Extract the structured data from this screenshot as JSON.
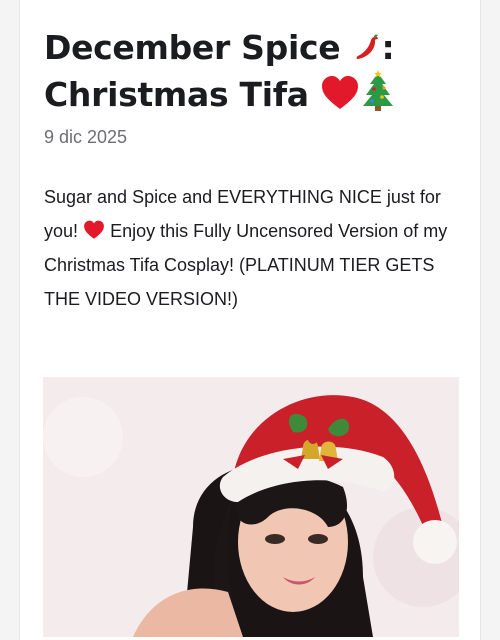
{
  "post": {
    "title": "December Spice 🌶️: Christmas Tifa ❤️🎄",
    "title_line1": "December Spice",
    "title_line1_suffix": ":",
    "title_line2": "Christmas Tifa",
    "date": "9 dic 2025",
    "body_part1": "Sugar and Spice and EVERYTHING NICE just for you!",
    "body_part2": "Enjoy this Fully Uncensored Version of my Christmas Tifa Cosplay! (PLATINUM TIER GETS THE VIDEO VERSION!)"
  },
  "icons": {
    "pepper": "chili-pepper-icon",
    "heart": "red-heart-icon",
    "tree": "christmas-tree-icon",
    "photo": "cosplay-photo"
  },
  "colors": {
    "text": "#1b1c1f",
    "muted": "#6e6f74",
    "heart": "#e2182b",
    "santa_red": "#c9202a"
  }
}
